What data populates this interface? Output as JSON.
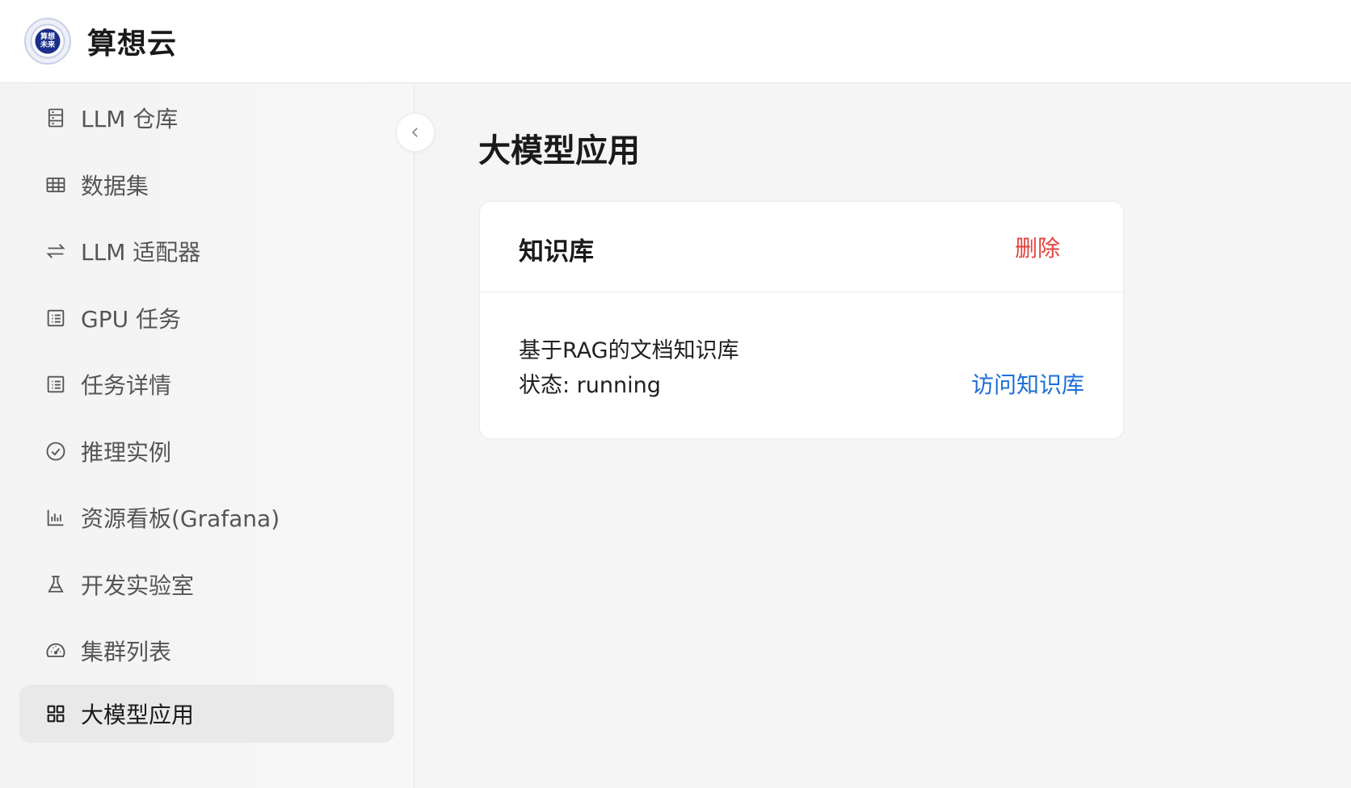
{
  "app": {
    "title": "算想云",
    "logo_text": "算想未来"
  },
  "sidebar": {
    "items": [
      {
        "label": "LLM 仓库",
        "icon": "server-icon"
      },
      {
        "label": "数据集",
        "icon": "table-icon"
      },
      {
        "label": "LLM 适配器",
        "icon": "swap-icon"
      },
      {
        "label": "GPU 任务",
        "icon": "list-icon"
      },
      {
        "label": "任务详情",
        "icon": "list-icon"
      },
      {
        "label": "推理实例",
        "icon": "check-circle-icon"
      },
      {
        "label": "资源看板(Grafana)",
        "icon": "bar-chart-icon"
      },
      {
        "label": "开发实验室",
        "icon": "flask-icon"
      },
      {
        "label": "集群列表",
        "icon": "dashboard-icon"
      },
      {
        "label": "大模型应用",
        "icon": "grid-icon",
        "active": true
      }
    ]
  },
  "main": {
    "page_title": "大模型应用",
    "card": {
      "title": "知识库",
      "delete_label": "删除",
      "description": "基于RAG的文档知识库",
      "status": "状态: running",
      "visit_label": "访问知识库"
    }
  },
  "colors": {
    "danger": "#e5433b",
    "link": "#1e6fd9",
    "active_bg": "#e9e9e9"
  }
}
